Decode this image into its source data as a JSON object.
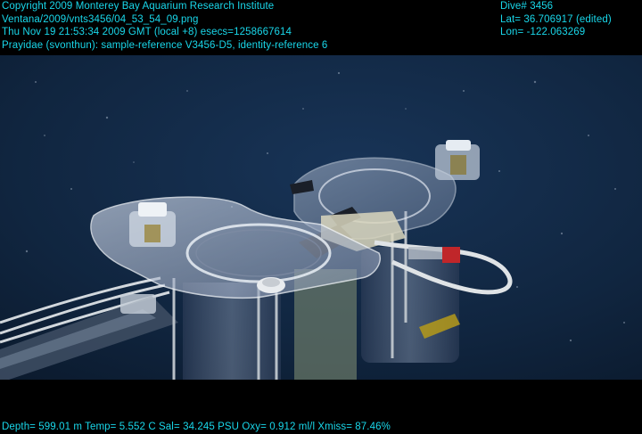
{
  "overlay": {
    "top_left": [
      "Copyright 2009 Monterey Bay Aquarium Research Institute",
      "Ventana/2009/vnts3456/04_53_54_09.png",
      "Thu Nov 19 21:53:34 2009 GMT (local +8)  esecs=1258667614",
      "Prayidae (svonthun): sample-reference V3456-D5, identity-reference 6"
    ],
    "top_right": [
      "Dive# 3456",
      "Lat= 36.706917 (edited)",
      "Lon= -122.063269"
    ],
    "bottom": "Depth= 599.01 m  Temp= 5.552 C  Sal= 34.245 PSU  Oxy= 0.912 ml/l  Xmiss= 87.46%"
  },
  "colors": {
    "overlay_text": "#19d7ea",
    "water": "#0f2440",
    "letterbox": "#000000"
  }
}
